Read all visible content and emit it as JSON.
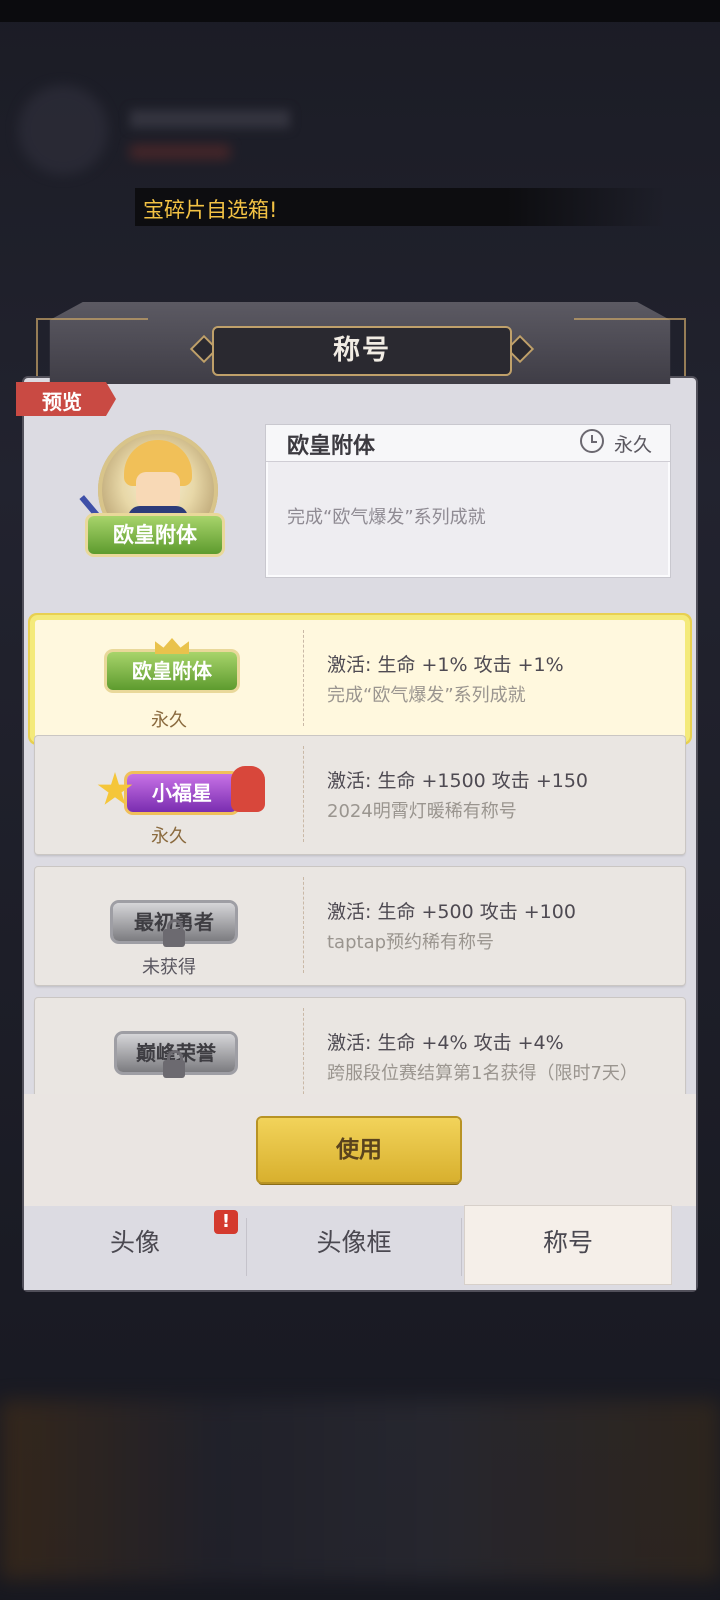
{
  "ticker": {
    "text": "宝碎片自选箱!"
  },
  "header": {
    "title": "称号",
    "preview_tag": "预览"
  },
  "preview": {
    "badge_text": "欧皇附体",
    "name": "欧皇附体",
    "duration": "永久",
    "description": "完成“欧气爆发”系列成就"
  },
  "titles": [
    {
      "badge_text": "欧皇附体",
      "status": "永久",
      "bonus": "激活: 生命 +1% 攻击 +1%",
      "source": "完成“欧气爆发”系列成就",
      "selected": true
    },
    {
      "badge_text": "小福星",
      "status": "永久",
      "bonus": "激活: 生命 +1500 攻击 +150",
      "source": "2024明霄灯暖稀有称号",
      "selected": false
    },
    {
      "badge_text": "最初勇者",
      "status": "未获得",
      "bonus": "激活: 生命 +500 攻击 +100",
      "source": "taptap预约稀有称号",
      "selected": false
    },
    {
      "badge_text": "巅峰荣誉",
      "status": "",
      "bonus": "激活: 生命 +4% 攻击 +4%",
      "source": "跨服段位赛结算第1名获得（限时7天）",
      "selected": false
    }
  ],
  "use_button": "使用",
  "tabs": [
    {
      "label": "头像",
      "alert": "!"
    },
    {
      "label": "头像框"
    },
    {
      "label": "称号"
    }
  ],
  "colors": {
    "accent_yellow": "#f2d35a",
    "tag_red": "#c94a43",
    "ticker_text": "#f3c244"
  }
}
